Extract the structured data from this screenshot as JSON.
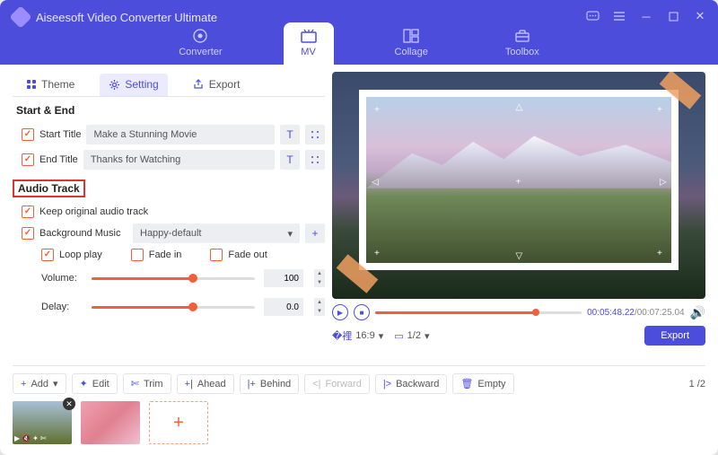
{
  "app_title": "Aiseesoft Video Converter Ultimate",
  "nav": {
    "converter": "Converter",
    "mv": "MV",
    "collage": "Collage",
    "toolbox": "Toolbox"
  },
  "tabs": {
    "theme": "Theme",
    "setting": "Setting",
    "export": "Export"
  },
  "sections": {
    "start_end": "Start & End",
    "audio_track": "Audio Track"
  },
  "labels": {
    "start_title": "Start Title",
    "end_title": "End Title",
    "keep_audio": "Keep original audio track",
    "bg_music": "Background Music",
    "loop": "Loop play",
    "fade_in": "Fade in",
    "fade_out": "Fade out",
    "volume": "Volume:",
    "delay": "Delay:"
  },
  "values": {
    "start_title": "Make a Stunning Movie",
    "end_title": "Thanks for Watching",
    "bg_music": "Happy-default",
    "volume": "100",
    "delay": "0.0"
  },
  "playback": {
    "current": "00:05:48.22",
    "total": "00:07:25.04",
    "aspect": "16:9",
    "page": "1/2"
  },
  "toolbar": {
    "add": "Add",
    "edit": "Edit",
    "trim": "Trim",
    "ahead": "Ahead",
    "behind": "Behind",
    "forward": "Forward",
    "backward": "Backward",
    "empty": "Empty"
  },
  "export_btn": "Export",
  "thumb_page": {
    "cur": "1",
    "total": "2"
  }
}
